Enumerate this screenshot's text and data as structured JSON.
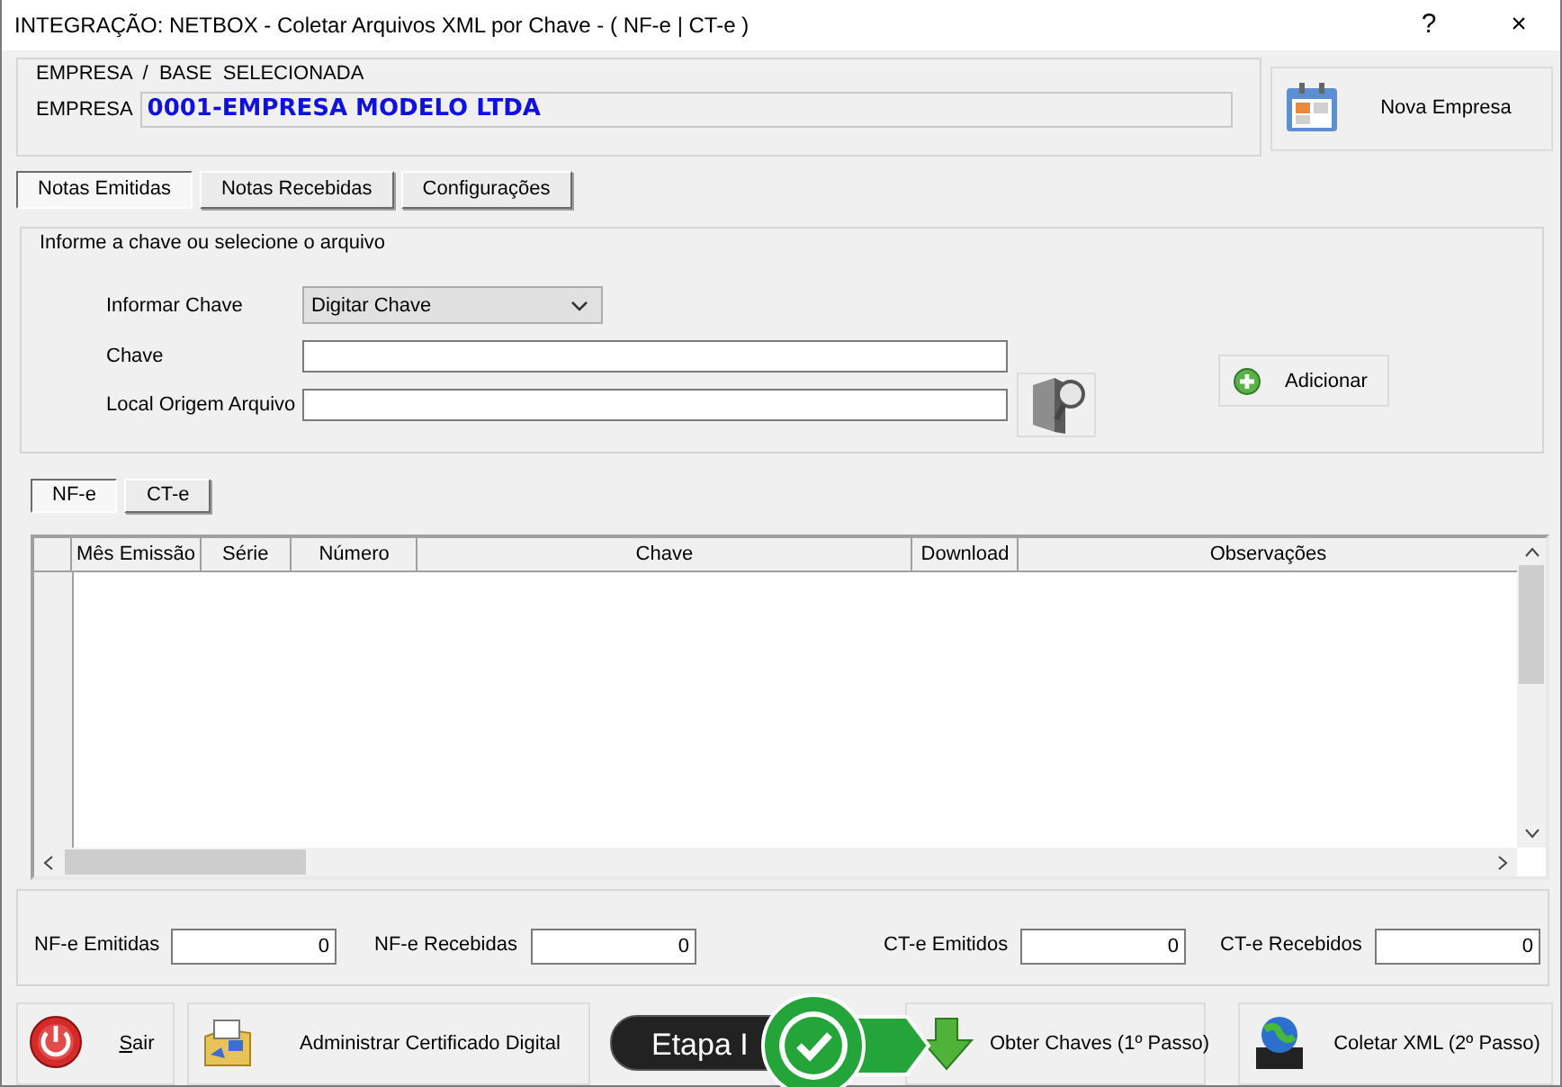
{
  "window": {
    "title": "INTEGRAÇÃO: NETBOX - Coletar Arquivos XML por Chave - ( NF-e | CT-e )",
    "help": "?",
    "close": "×"
  },
  "empresa_group": {
    "title": "EMPRESA  /  BASE  SELECIONADA",
    "label": "EMPRESA",
    "value": "0001-EMPRESA MODELO LTDA"
  },
  "nova_empresa_button": {
    "label": "Nova Empresa"
  },
  "tabs": [
    {
      "label": "Notas Emitidas",
      "selected": true
    },
    {
      "label": "Notas Recebidas",
      "selected": false
    },
    {
      "label": "Configurações",
      "selected": false
    }
  ],
  "key_group": {
    "title": "Informe a chave ou selecione o arquivo",
    "fields": [
      {
        "kind": "select",
        "label": "Informar Chave",
        "value": "Digitar Chave"
      },
      {
        "kind": "text",
        "label": "Chave"
      },
      {
        "kind": "text",
        "label": "Local Origem Arquivo"
      }
    ],
    "add_button": {
      "label": "Adicionar"
    }
  },
  "doc_tabs": [
    {
      "label": "NF-e",
      "selected": true
    },
    {
      "label": "CT-e",
      "selected": false
    }
  ],
  "table": {
    "columns": [
      "Mês Emissão",
      "Série",
      "Número",
      "Chave",
      "Download",
      "Observações"
    ]
  },
  "counters": [
    {
      "label": "NF-e Emitidas",
      "value": "0"
    },
    {
      "label": "NF-e Recebidas",
      "value": "0"
    },
    {
      "label": "CT-e Emitidos",
      "value": "0"
    },
    {
      "label": "CT-e Recebidos",
      "value": "0"
    }
  ],
  "buttons": [
    {
      "kind": "exit",
      "label": "Sair",
      "underline_first": true
    },
    {
      "kind": "certificate",
      "label": "Administrar Certificado Digital"
    },
    {
      "kind": "download",
      "label": "Obter Chaves (1º Passo)"
    },
    {
      "kind": "xml",
      "label": "Coletar XML (2º Passo)"
    }
  ],
  "step_badge": {
    "label": "Etapa I"
  }
}
